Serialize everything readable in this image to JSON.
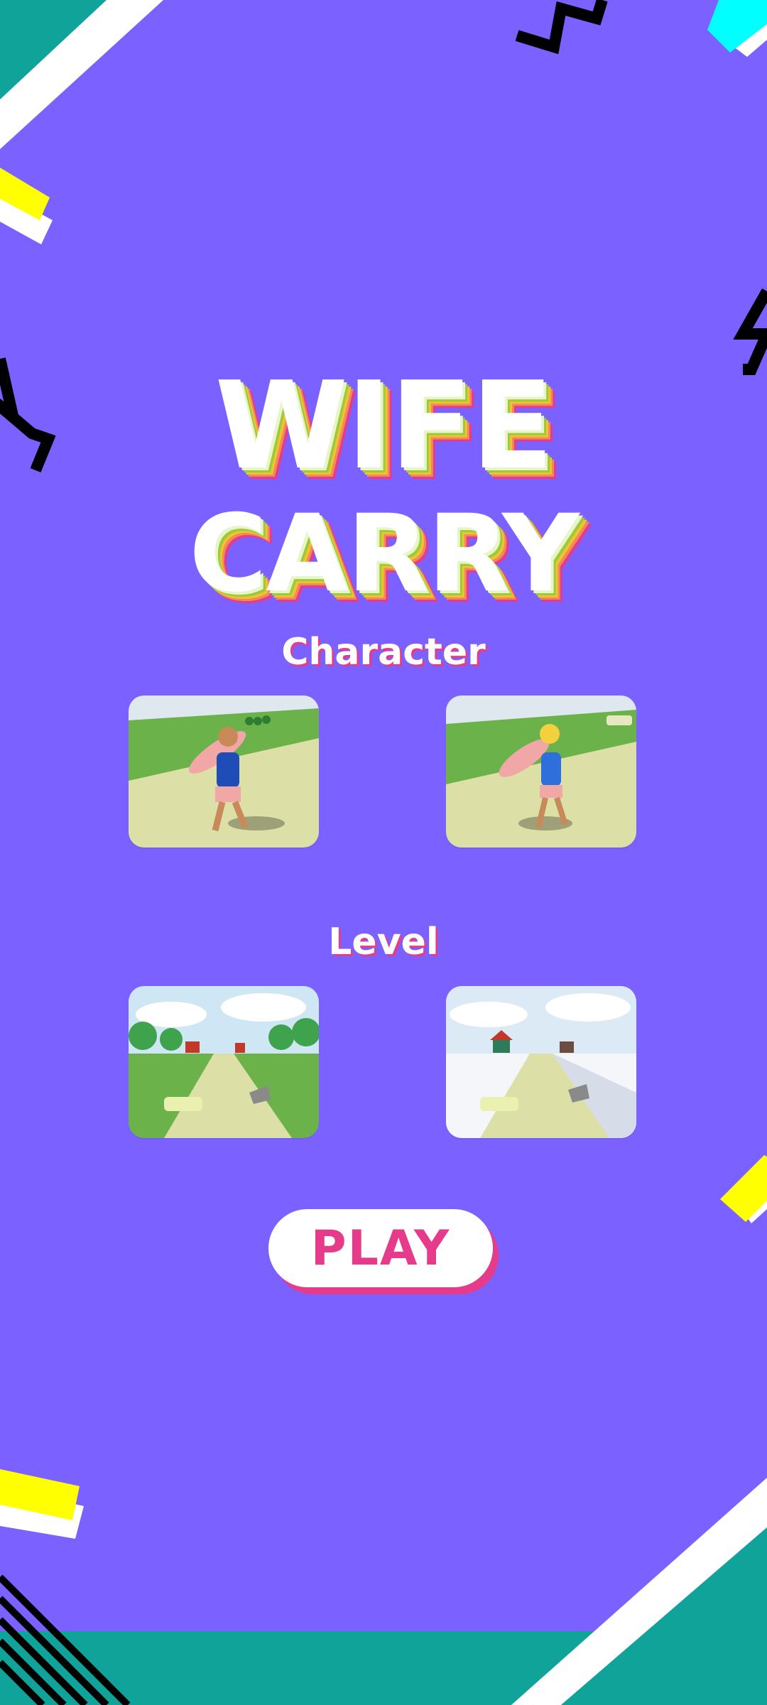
{
  "title": {
    "line1": "WIFE",
    "line2": "CARRY"
  },
  "sections": {
    "character": "Character",
    "level": "Level"
  },
  "characters": [
    {
      "name": "male-runner-icon"
    },
    {
      "name": "female-runner-icon"
    }
  ],
  "levels": [
    {
      "name": "summer-level-icon"
    },
    {
      "name": "winter-level-icon"
    }
  ],
  "play": {
    "label": "PLAY"
  },
  "colors": {
    "background": "#7B61FF",
    "accent": "#E63B8A",
    "teal": "#0FA39A",
    "yellow": "#FFFF00",
    "cyan": "#00FFFF"
  }
}
